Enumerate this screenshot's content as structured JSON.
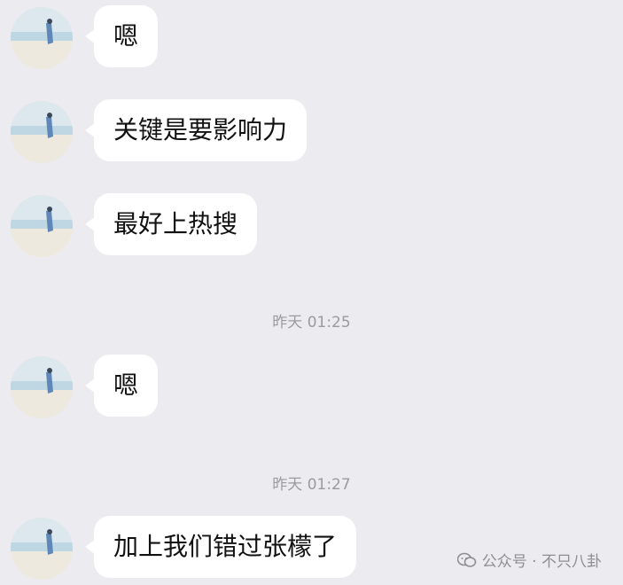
{
  "messages": [
    {
      "type": "incoming",
      "text": "嗯"
    },
    {
      "type": "incoming",
      "text": "关键是要影响力"
    },
    {
      "type": "incoming",
      "text": "最好上热搜"
    },
    {
      "type": "timestamp",
      "text": "昨天 01:25"
    },
    {
      "type": "incoming",
      "text": "嗯"
    },
    {
      "type": "timestamp",
      "text": "昨天 01:27"
    },
    {
      "type": "incoming",
      "text": "加上我们错过张檬了"
    }
  ],
  "watermark": {
    "text": "公众号 · 不只八卦",
    "icon": "wechat-official-account-icon"
  },
  "colors": {
    "background": "#ebebf0",
    "bubble": "#ffffff",
    "timestamp_text": "#9a9aa0"
  }
}
